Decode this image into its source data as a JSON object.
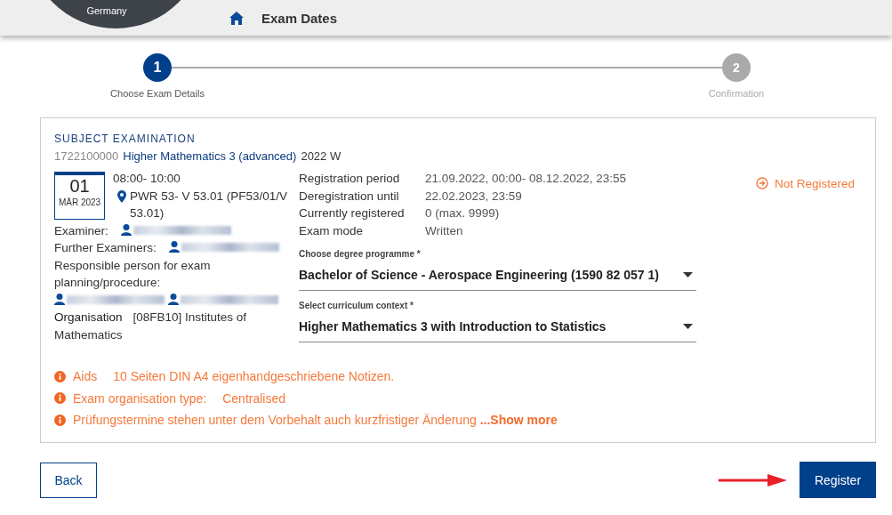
{
  "header": {
    "location": "Germany",
    "title": "Exam Dates"
  },
  "stepper": [
    {
      "number": "1",
      "label": "Choose Exam Details",
      "selected": true
    },
    {
      "number": "2",
      "label": "Confirmation",
      "selected": false
    }
  ],
  "exam": {
    "category": "SUBJECT EXAMINATION",
    "code": "1722100000",
    "title": "Higher Mathematics 3 (advanced)",
    "semester": "2022 W",
    "date": {
      "day": "01",
      "month": "MÄR 2023"
    },
    "time": "08:00- 10:00",
    "room": "PWR 53- V 53.01 (PF53/01/V 53.01)",
    "people": [
      {
        "label": "Examiner:",
        "persons": [
          {
            "kind": "redacted"
          }
        ]
      },
      {
        "label": "Further Examiners:",
        "persons": [
          {
            "kind": "redacted"
          }
        ]
      },
      {
        "label": "Responsible person for exam planning/procedure:",
        "persons": [
          {
            "kind": "redacted"
          },
          {
            "kind": "redacted"
          }
        ]
      }
    ],
    "organisation": {
      "label": "Organisation",
      "value": "[08FB10] Institutes of Mathematics"
    },
    "details": [
      {
        "label": "Registration period",
        "value": "21.09.2022, 00:00- 08.12.2022, 23:55"
      },
      {
        "label": "Deregistration until",
        "value": "22.02.2023, 23:59"
      },
      {
        "label": "Currently registered",
        "value": "0 (max. 9999)"
      },
      {
        "label": "Exam mode",
        "value": "Written"
      }
    ],
    "selects": [
      {
        "label": "Choose degree programme *",
        "value": "Bachelor of Science - Aerospace Engineering (1590 82 057 1)"
      },
      {
        "label": "Select curriculum context *",
        "value": "Higher Mathematics 3 with Introduction to Statistics"
      }
    ],
    "status": "Not Registered",
    "notes": [
      {
        "kind": "labeled",
        "label": "Aids",
        "value": "10 Seiten DIN A4 eigenhandgeschriebene Notizen."
      },
      {
        "kind": "labeled",
        "label": "Exam organisation type:",
        "value": "Centralised"
      },
      {
        "kind": "more",
        "text": "Prüfungstermine stehen unter dem Vorbehalt auch kurzfristiger Änderung",
        "link": "...Show more"
      }
    ]
  },
  "buttons": {
    "back": "Back",
    "register": "Register"
  }
}
